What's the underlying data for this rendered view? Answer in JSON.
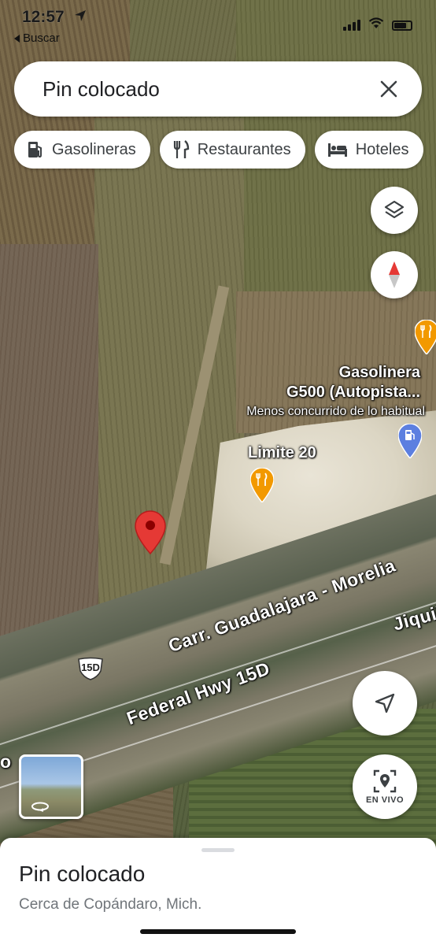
{
  "status_bar": {
    "time": "12:57",
    "back_app": "Buscar"
  },
  "search": {
    "value": "Pin colocado"
  },
  "chips": [
    {
      "label": "Gasolineras",
      "icon": "gas-station-icon"
    },
    {
      "label": "Restaurantes",
      "icon": "restaurant-icon"
    },
    {
      "label": "Hoteles",
      "icon": "hotel-bed-icon"
    }
  ],
  "map": {
    "poi_gas_name_line1": "Gasolinera",
    "poi_gas_name_line2": "G500 (Autopista...",
    "poi_gas_status": "Menos concurrido de lo habitual",
    "poi_restaurant_name": "Limite 20",
    "road_1": "Carr. Guadalajara - Morelia",
    "road_2": "Federal Hwy 15D",
    "road_3": "Jiquil",
    "road_shield": "15D",
    "edge_letter": "o"
  },
  "live_view": {
    "label": "EN VIVO"
  },
  "sheet": {
    "title": "Pin colocado",
    "subtitle": "Cerca de Copándaro, Mich."
  },
  "colors": {
    "pin_red": "#e53935",
    "poi_orange": "#f29900",
    "poi_blue": "#5c7fe0"
  }
}
